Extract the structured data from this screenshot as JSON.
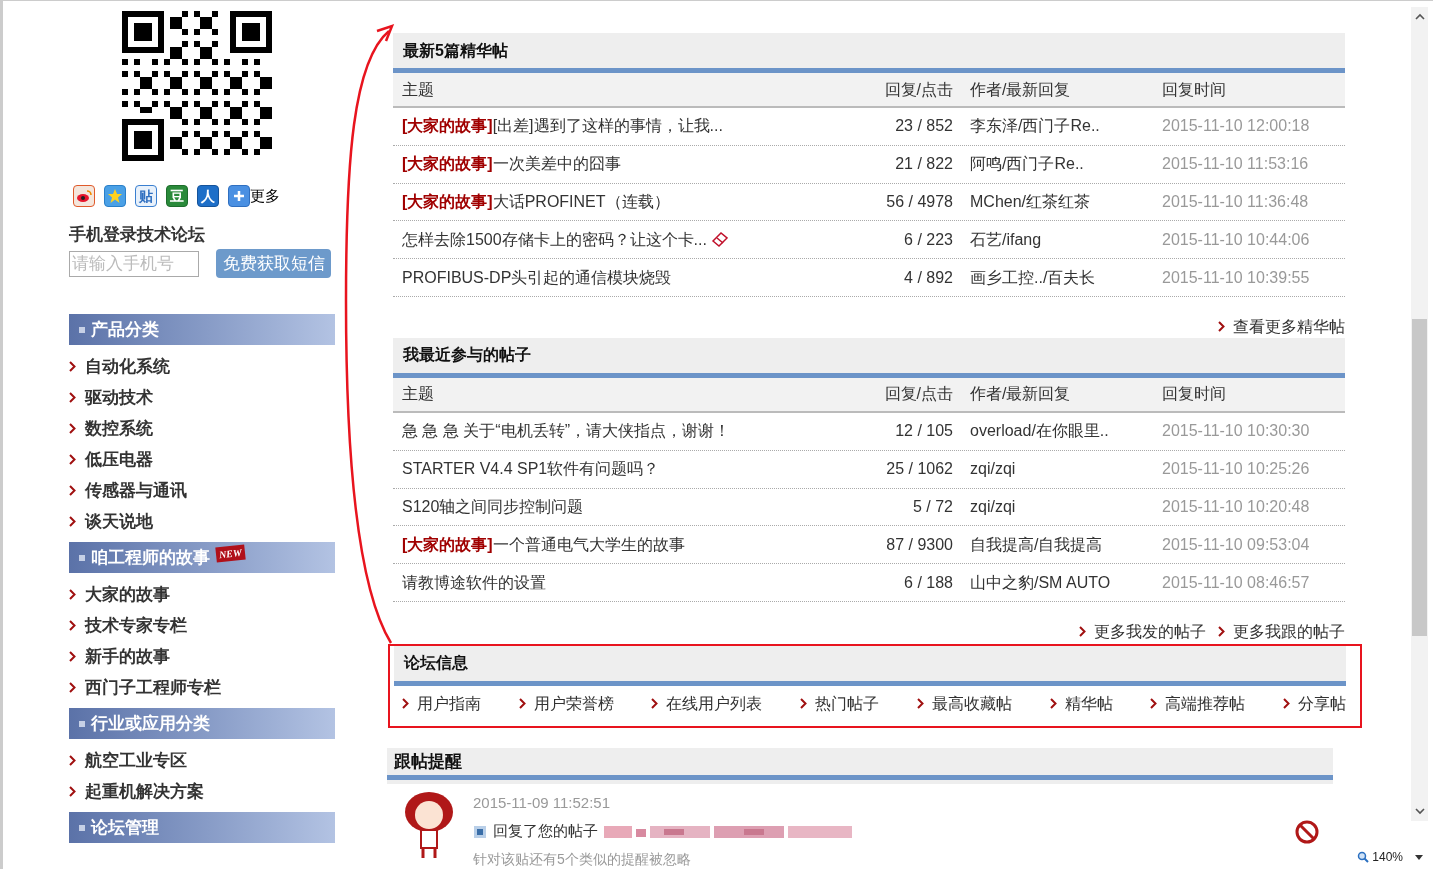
{
  "sidebar": {
    "share_buttons": [
      {
        "kind": "weibo"
      },
      {
        "kind": "qzone"
      },
      {
        "kind": "tieba",
        "label": "贴"
      },
      {
        "kind": "douban",
        "label": "豆"
      },
      {
        "kind": "renren",
        "label": "人"
      },
      {
        "kind": "more"
      }
    ],
    "share_more": "更多",
    "mobile_login": {
      "title": "手机登录技术论坛",
      "placeholder": "请输入手机号",
      "button": "免费获取短信"
    },
    "sections": [
      {
        "title": "产品分类",
        "items": [
          "自动化系统",
          "驱动技术",
          "数控系统",
          "低压电器",
          "传感器与通讯",
          "谈天说地"
        ]
      },
      {
        "title": "咱工程师的故事",
        "badge": "NEW",
        "items": [
          "大家的故事",
          "技术专家专栏",
          "新手的故事",
          "西门子工程师专栏"
        ]
      },
      {
        "title": "行业或应用分类",
        "items": [
          "航空工业专区",
          "起重机解决方案"
        ]
      },
      {
        "title": "论坛管理"
      }
    ]
  },
  "tables": [
    {
      "title": "最新5篇精华帖",
      "columns": [
        "主题",
        "回复/点击",
        "作者/最新回复",
        "回复时间"
      ],
      "rows": [
        {
          "tag": "[大家的故事]",
          "title": "[出差]遇到了这样的事情，让我...",
          "counts": "23 / 852",
          "author": "李东泽/西门子Re..",
          "time": "2015-11-10 12:00:18"
        },
        {
          "tag": "[大家的故事]",
          "title": "一次美差中的囧事",
          "counts": "21 / 822",
          "author": "阿鸣/西门子Re..",
          "time": "2015-11-10 11:53:16"
        },
        {
          "tag": "[大家的故事]",
          "title": "大话PROFINET（连载）",
          "counts": "56 / 4978",
          "author": "MChen/红茶红茶",
          "time": "2015-11-10 11:36:48"
        },
        {
          "title": "怎样去除1500存储卡上的密码？让这个卡...",
          "icon": true,
          "counts": "6 / 223",
          "author": "石艺/ifang",
          "time": "2015-11-10 10:44:06"
        },
        {
          "title": "PROFIBUS-DP头引起的通信模块烧毁",
          "counts": "4 / 892",
          "author": "画乡工控../百夫长",
          "time": "2015-11-10 10:39:55"
        }
      ],
      "more_links": [
        "查看更多精华帖"
      ]
    },
    {
      "title": "我最近参与的帖子",
      "columns": [
        "主题",
        "回复/点击",
        "作者/最新回复",
        "回复时间"
      ],
      "rows": [
        {
          "title": "急 急 急 关于“电机丢转”，请大侠指点，谢谢！",
          "counts": "12 / 105",
          "author": "overload/在你眼里..",
          "time": "2015-11-10 10:30:30"
        },
        {
          "title": "STARTER V4.4 SP1软件有问题吗？",
          "counts": "25 / 1062",
          "author": "zqi/zqi",
          "time": "2015-11-10 10:25:26"
        },
        {
          "title": "S120轴之间同步控制问题",
          "counts": "5 / 72",
          "author": "zqi/zqi",
          "time": "2015-11-10 10:20:48"
        },
        {
          "tag": "[大家的故事]",
          "title": "一个普通电气大学生的故事",
          "counts": "87 / 9300",
          "author": "自我提高/自我提高",
          "time": "2015-11-10 09:53:04"
        },
        {
          "title": "请教博途软件的设置",
          "counts": "6 / 188",
          "author": "山中之豹/SM AUTO",
          "time": "2015-11-10 08:46:57"
        }
      ],
      "more_links": [
        "更多我发的帖子",
        "更多我跟的帖子"
      ]
    }
  ],
  "forum_info": {
    "title": "论坛信息",
    "highlighted": true,
    "links": [
      "用户指南",
      "用户荣誉榜",
      "在线用户列表",
      "热门帖子",
      "最高收藏帖",
      "精华帖",
      "高端推荐帖",
      "分享帖"
    ]
  },
  "reminders": {
    "title": "跟帖提醒",
    "items": [
      {
        "time": "2015-11-09 11:52:51",
        "action": "回复了您的帖子",
        "note": "针对该贴还有5个类似的提醒被忽略"
      }
    ]
  },
  "status_bar": {
    "zoom": "140%"
  }
}
